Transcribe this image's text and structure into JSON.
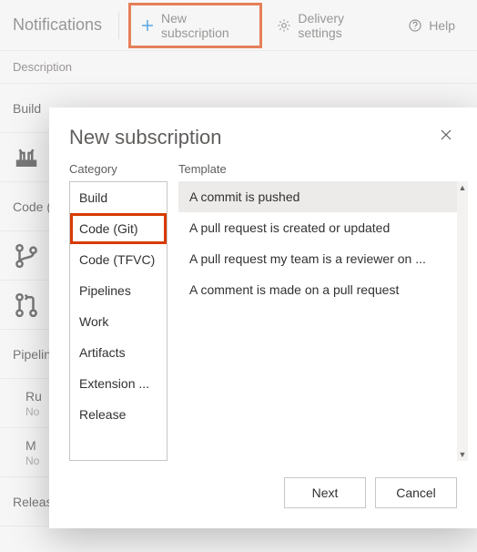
{
  "topbar": {
    "title": "Notifications",
    "new_subscription": "New subscription",
    "delivery_settings": "Delivery settings",
    "help": "Help"
  },
  "list": {
    "header": "Description",
    "groups": [
      {
        "label": "Build"
      },
      {
        "label": "Code (Git)"
      },
      {
        "label": "Pipelines",
        "items": [
          {
            "title": "Ru",
            "meta": "No"
          },
          {
            "title": "M",
            "meta": "No"
          }
        ]
      },
      {
        "label": "Release"
      }
    ]
  },
  "dialog": {
    "title": "New subscription",
    "category_label": "Category",
    "template_label": "Template",
    "categories": [
      "Build",
      "Code (Git)",
      "Code (TFVC)",
      "Pipelines",
      "Work",
      "Artifacts",
      "Extension ...",
      "Release"
    ],
    "selected_category_index": 1,
    "templates": [
      "A commit is pushed",
      "A pull request is created or updated",
      "A pull request my team is a reviewer on ...",
      "A comment is made on a pull request"
    ],
    "selected_template_index": 0,
    "buttons": {
      "next": "Next",
      "cancel": "Cancel"
    }
  }
}
